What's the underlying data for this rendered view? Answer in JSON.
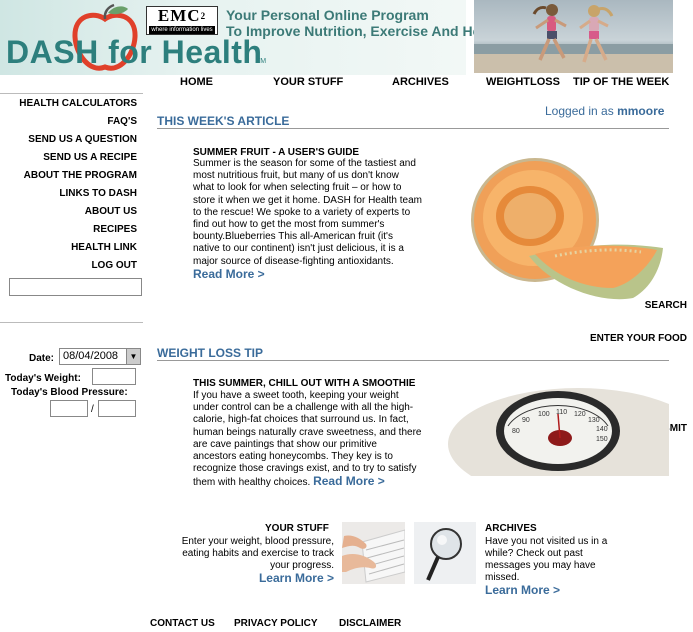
{
  "brand": {
    "logo_text": "DASH for Health",
    "logo_tm": "TM",
    "sponsor_name": "EMC",
    "sponsor_sup": "2",
    "sponsor_tagline": "where information lives",
    "tagline_line1": "Your Personal Online Program",
    "tagline_line2": "To Improve Nutrition, Exercise And Health"
  },
  "nav": {
    "items": [
      {
        "label": "HOME"
      },
      {
        "label": "YOUR STUFF"
      },
      {
        "label": "ARCHIVES"
      },
      {
        "label": "WEIGHTLOSS"
      },
      {
        "label": "TIP OF THE WEEK"
      }
    ]
  },
  "sidebar": {
    "links": [
      {
        "label": "HEALTH CALCULATORS"
      },
      {
        "label": "FAQ'S"
      },
      {
        "label": "SEND US A QUESTION"
      },
      {
        "label": "SEND US A RECIPE"
      },
      {
        "label": "ABOUT THE PROGRAM"
      },
      {
        "label": "LINKS TO DASH"
      },
      {
        "label": "ABOUT US"
      },
      {
        "label": "RECIPES"
      },
      {
        "label": "HEALTH LINK"
      },
      {
        "label": "LOG OUT"
      }
    ],
    "search_value": "",
    "search_label": "SEARCH",
    "food_heading": "ENTER YOUR FOOD",
    "date_label": "Date:",
    "date_value": "08/04/2008",
    "weight_label": "Today's Weight:",
    "weight_value": "",
    "bp_label": "Today's Blood Pressure:",
    "bp_systolic": "",
    "bp_separator": "/",
    "bp_diastolic": "",
    "submit_label": "SUBMIT"
  },
  "session": {
    "logged_in_prefix": "Logged in as",
    "username": "mmoore"
  },
  "article": {
    "section_title": "THIS WEEK'S ARTICLE",
    "heading": "SUMMER FRUIT - A USER'S GUIDE",
    "lines": [
      "Summer is the season for some of the tastiest and",
      "most nutritious fruit, but many of us don't know",
      "what to look for when selecting fruit – or how to",
      "store it when we get it home. DASH for Health team",
      "to the rescue! We spoke to a variety of experts to",
      "find out how to get the most from summer's",
      "bounty.Blueberries This all-American fruit (it's",
      "native to our continent) isn't just delicious, it is a",
      "major source of disease-fighting antioxidants."
    ],
    "read_more": "Read More >"
  },
  "tip": {
    "section_title": "WEIGHT LOSS TIP",
    "heading": "THIS SUMMER, CHILL OUT WITH A SMOOTHIE",
    "lines": [
      "If you have a sweet tooth, keeping your weight",
      "under control can be a challenge with all the high-",
      "calorie, high-fat choices that surround us. In fact,",
      "human beings naturally crave sweetness, and there",
      "are cave paintings that show our primitive",
      "ancestors eating honeycombs. They key is to",
      "recognize those cravings exist, and to try to satisfy"
    ],
    "last_line": "them with healthy choices.",
    "read_more": "Read More >"
  },
  "promos": {
    "your_stuff": {
      "title": "YOUR STUFF",
      "text": "Enter your weight, blood pressure, eating habits and exercise to track your progress.",
      "link": "Learn More >"
    },
    "archives": {
      "title": "ARCHIVES",
      "text": "Have you not visited us in a while? Check out past messages you may have missed.",
      "link": "Learn More >"
    }
  },
  "scale_numbers": [
    "80",
    "90",
    "100",
    "110",
    "120",
    "130",
    "140",
    "150"
  ],
  "footer": {
    "links": [
      {
        "label": "CONTACT US"
      },
      {
        "label": "PRIVACY POLICY"
      },
      {
        "label": "DISCLAIMER"
      }
    ]
  },
  "colors": {
    "accent_blue": "#3a6b9a",
    "logo_teal": "#2d7f7d",
    "apple_red": "#e0402a"
  }
}
